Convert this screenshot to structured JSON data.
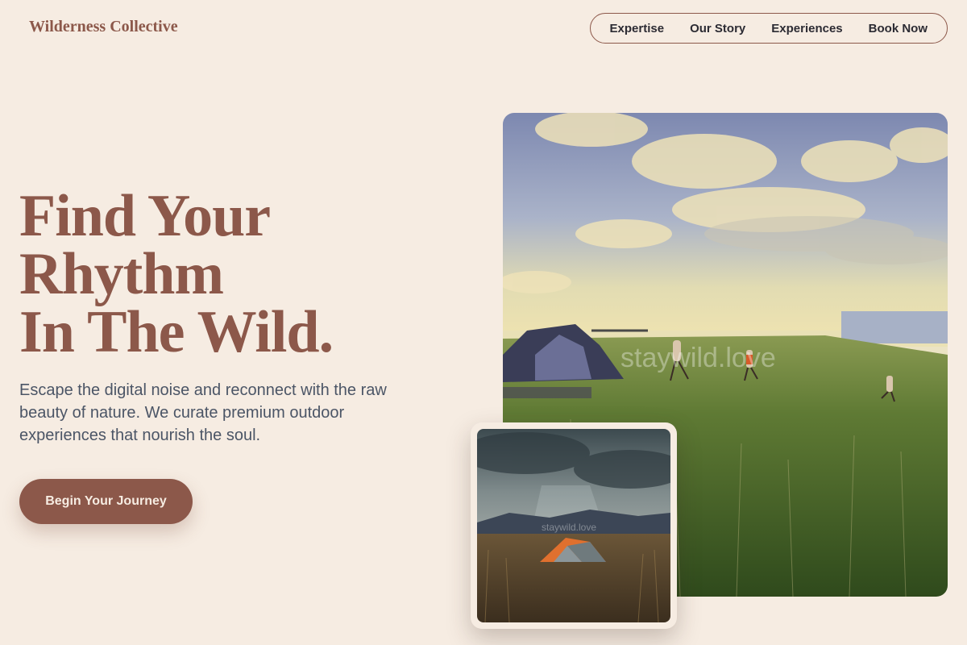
{
  "brand": {
    "name": "Wilderness Collective"
  },
  "nav": {
    "items": [
      {
        "label": "Expertise"
      },
      {
        "label": "Our Story"
      },
      {
        "label": "Experiences"
      },
      {
        "label": "Book Now"
      }
    ]
  },
  "hero": {
    "headline": [
      "Find Your",
      "Rhythm",
      "In The Wild."
    ],
    "subtext": "Escape the digital noise and reconnect with the raw beauty of nature. We curate premium outdoor experiences that nourish the soul.",
    "cta_label": "Begin Your Journey"
  },
  "images": {
    "main_watermark": "staywild.love",
    "inset_watermark": "staywild.love"
  },
  "colors": {
    "background": "#f6ece2",
    "accent": "#8c584a",
    "text_body": "#4b5566",
    "nav_text": "#2c2b33"
  }
}
